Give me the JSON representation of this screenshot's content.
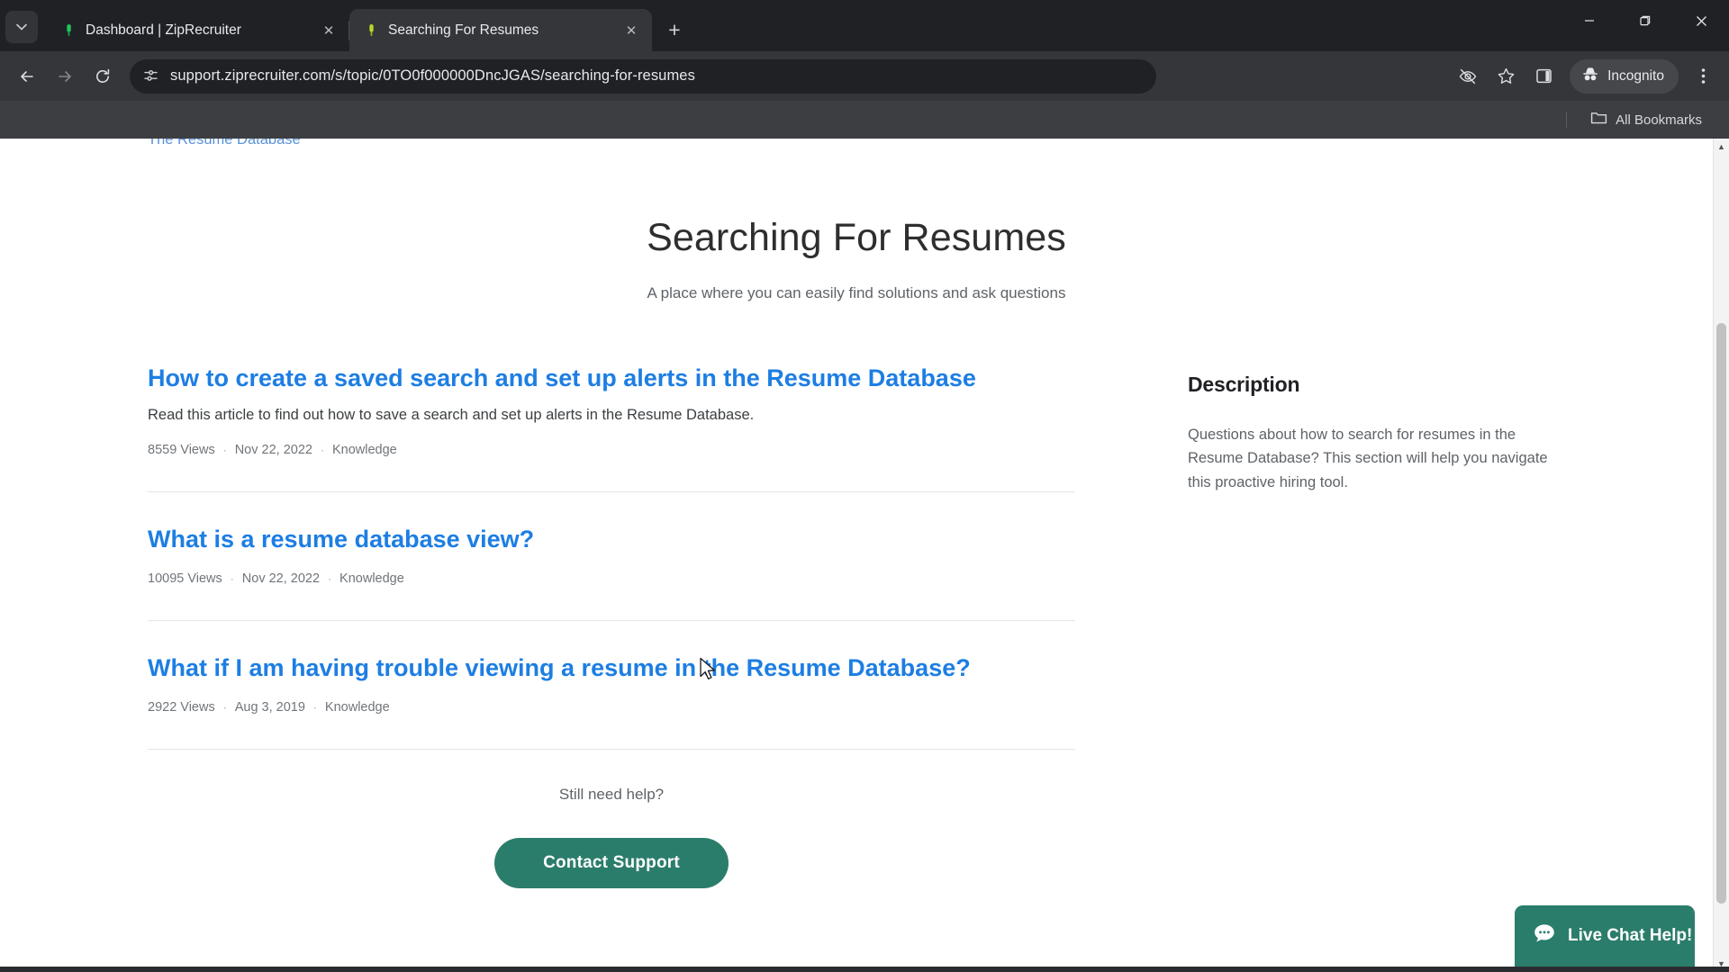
{
  "browser": {
    "tab_search_icon": "chevron-down-icon",
    "tabs": [
      {
        "title": "Dashboard | ZipRecruiter",
        "favicon": "ziprecruiter-icon",
        "close_label": "✕",
        "active": false
      },
      {
        "title": "Searching For Resumes",
        "favicon": "ziprecruiter-icon",
        "close_label": "✕",
        "active": true
      }
    ],
    "new_tab_label": "+",
    "window_controls": {
      "minimize": "—",
      "maximize": "❐",
      "close": "✕"
    },
    "nav": {
      "back": "←",
      "forward": "→",
      "reload": "⟳"
    },
    "omnibox": {
      "url": "support.ziprecruiter.com/s/topic/0TO0f000000DncJGAS/searching-for-resumes",
      "site_info_icon": "site-settings-icon"
    },
    "toolbar_icons": [
      {
        "name": "eye-slash-icon"
      },
      {
        "name": "star-icon"
      },
      {
        "name": "side-panel-icon"
      }
    ],
    "incognito_label": "Incognito",
    "incognito_icon": "incognito-hat-icon",
    "menu_icon": "three-dot-menu-icon",
    "bookmarks": {
      "all_bookmarks_label": "All Bookmarks",
      "folder_icon": "folder-icon"
    }
  },
  "page": {
    "breadcrumb": "The Resume Database",
    "title": "Searching For Resumes",
    "subtitle": "A place where you can easily find solutions and ask questions",
    "articles": [
      {
        "title": "How to create a saved search and set up alerts in the Resume Database",
        "description": "Read this article to find out how to save a search and set up alerts in the Resume Database.",
        "views": "8559 Views",
        "date": "Nov 22, 2022",
        "type": "Knowledge",
        "sep": "·"
      },
      {
        "title": "What is a resume database view?",
        "description": "",
        "views": "10095 Views",
        "date": "Nov 22, 2022",
        "type": "Knowledge",
        "sep": "·"
      },
      {
        "title": "What if I am having trouble viewing a resume in the Resume Database?",
        "description": "",
        "views": "2922 Views",
        "date": "Aug 3, 2019",
        "type": "Knowledge",
        "sep": "·"
      }
    ],
    "sidebar": {
      "heading": "Description",
      "body": "Questions about how to search for resumes in the Resume Database? This section will help you navigate this proactive hiring tool."
    },
    "footer": {
      "still_need_help": "Still need help?",
      "contact_support": "Contact Support"
    },
    "live_chat": {
      "label": "Live Chat Help!",
      "icon": "chat-bubble-icon",
      "collapse_icon": "chevron-down-icon"
    },
    "scrollbar": {
      "up_arrow": "▲",
      "down_arrow": "▼"
    }
  },
  "colors": {
    "chrome_bg": "#202124",
    "toolbar_bg": "#35363a",
    "bookmarks_bg": "#3d3e42",
    "link_blue": "#1d7ee3",
    "brand_green": "#2b7d6b",
    "breadcrumb_blue": "#5b93d6"
  }
}
